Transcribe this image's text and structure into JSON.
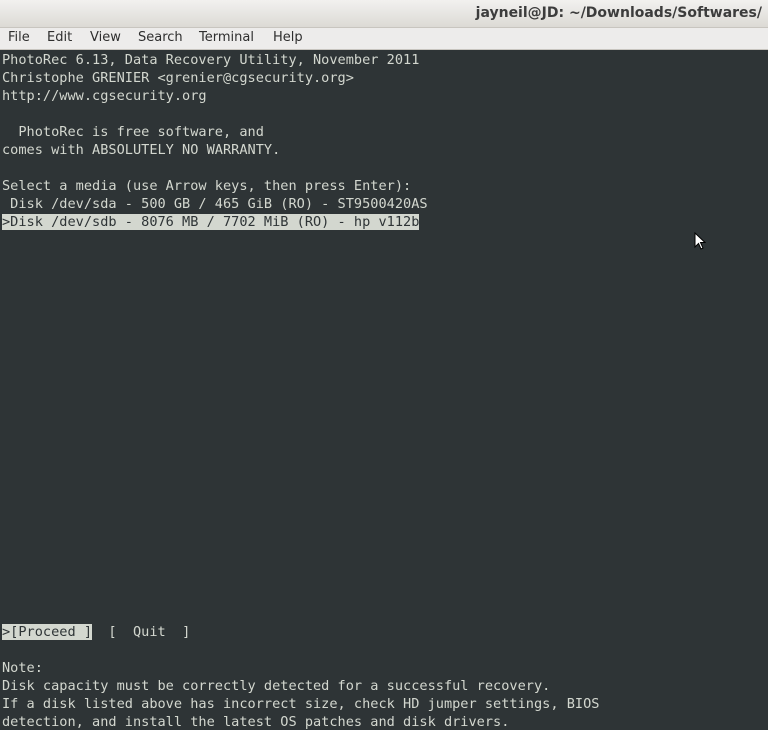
{
  "window": {
    "title": "jayneil@JD: ~/Downloads/Softwares/"
  },
  "menu": [
    "File",
    "Edit",
    "View",
    "Search",
    "Terminal",
    "Help"
  ],
  "terminal": {
    "header": [
      "PhotoRec 6.13, Data Recovery Utility, November 2011",
      "Christophe GRENIER <grenier@cgsecurity.org>",
      "http://www.cgsecurity.org"
    ],
    "license": [
      "  PhotoRec is free software, and",
      "comes with ABSOLUTELY NO WARRANTY."
    ],
    "prompt": "Select a media (use Arrow keys, then press Enter):",
    "disks": [
      " Disk /dev/sda - 500 GB / 465 GiB (RO) - ST9500420AS",
      ">Disk /dev/sdb - 8076 MB / 7702 MiB (RO) - hp v112b"
    ],
    "actions": {
      "proceed": ">[Proceed ]",
      "quit": "[  Quit  ]"
    },
    "note": [
      "Note:",
      "Disk capacity must be correctly detected for a successful recovery.",
      "If a disk listed above has incorrect size, check HD jumper settings, BIOS",
      "detection, and install the latest OS patches and disk drivers."
    ]
  },
  "colors": {
    "terminal_bg": "#2e3436",
    "terminal_fg": "#d3d7cf"
  }
}
